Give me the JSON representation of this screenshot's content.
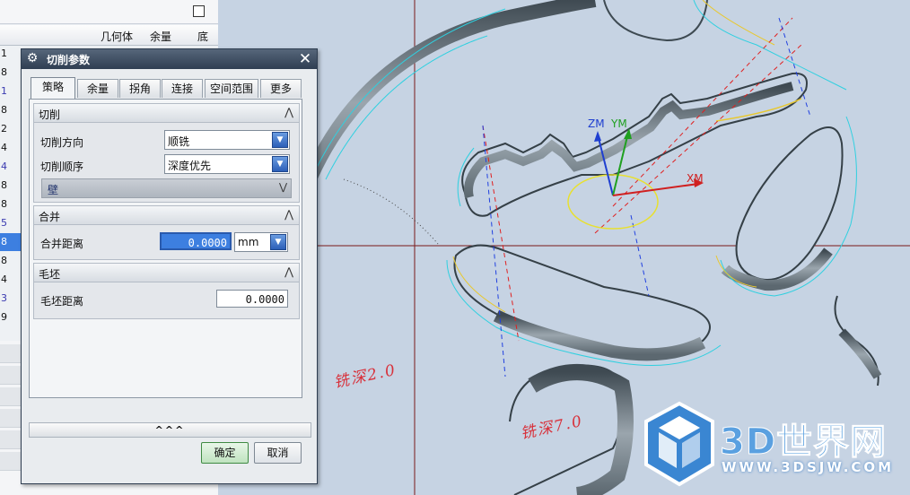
{
  "left_panel": {
    "columns": [
      "几何体",
      "余量",
      "底"
    ],
    "row_labels": [
      "1",
      "8",
      "1",
      "8",
      "2",
      "4",
      "4",
      "8",
      "8",
      "5",
      "8",
      "8",
      "4",
      "3",
      "9"
    ]
  },
  "dialog": {
    "title": "切削参数",
    "tabs": [
      "策略",
      "余量",
      "拐角",
      "连接",
      "空间范围",
      "更多"
    ],
    "active_tab": "策略",
    "groups": {
      "cutting": {
        "header": "切削",
        "direction_label": "切削方向",
        "direction_value": "顺铣",
        "order_label": "切削顺序",
        "order_value": "深度优先",
        "wall_label": "壁"
      },
      "merge": {
        "header": "合并",
        "distance_label": "合并距离",
        "distance_value": "0.0000",
        "unit_value": "mm"
      },
      "blank": {
        "header": "毛坯",
        "distance_label": "毛坯距离",
        "distance_value": "0.0000"
      }
    },
    "expander_label": "^^^",
    "ok_label": "确定",
    "cancel_label": "取消"
  },
  "viewport": {
    "axis_labels": {
      "zm": "ZM",
      "ym": "YM",
      "xm": "XM"
    },
    "annotation_1": "铣深2.0",
    "annotation_2": "铣深7.0",
    "colors": {
      "background": "#c6d3e3",
      "annotation": "#d8303a",
      "zm": "#1f3fd0",
      "ym": "#20a020",
      "xm": "#d02020"
    }
  },
  "watermark": {
    "brand": "3D世界网",
    "url": "WWW.3DSJW.COM"
  }
}
